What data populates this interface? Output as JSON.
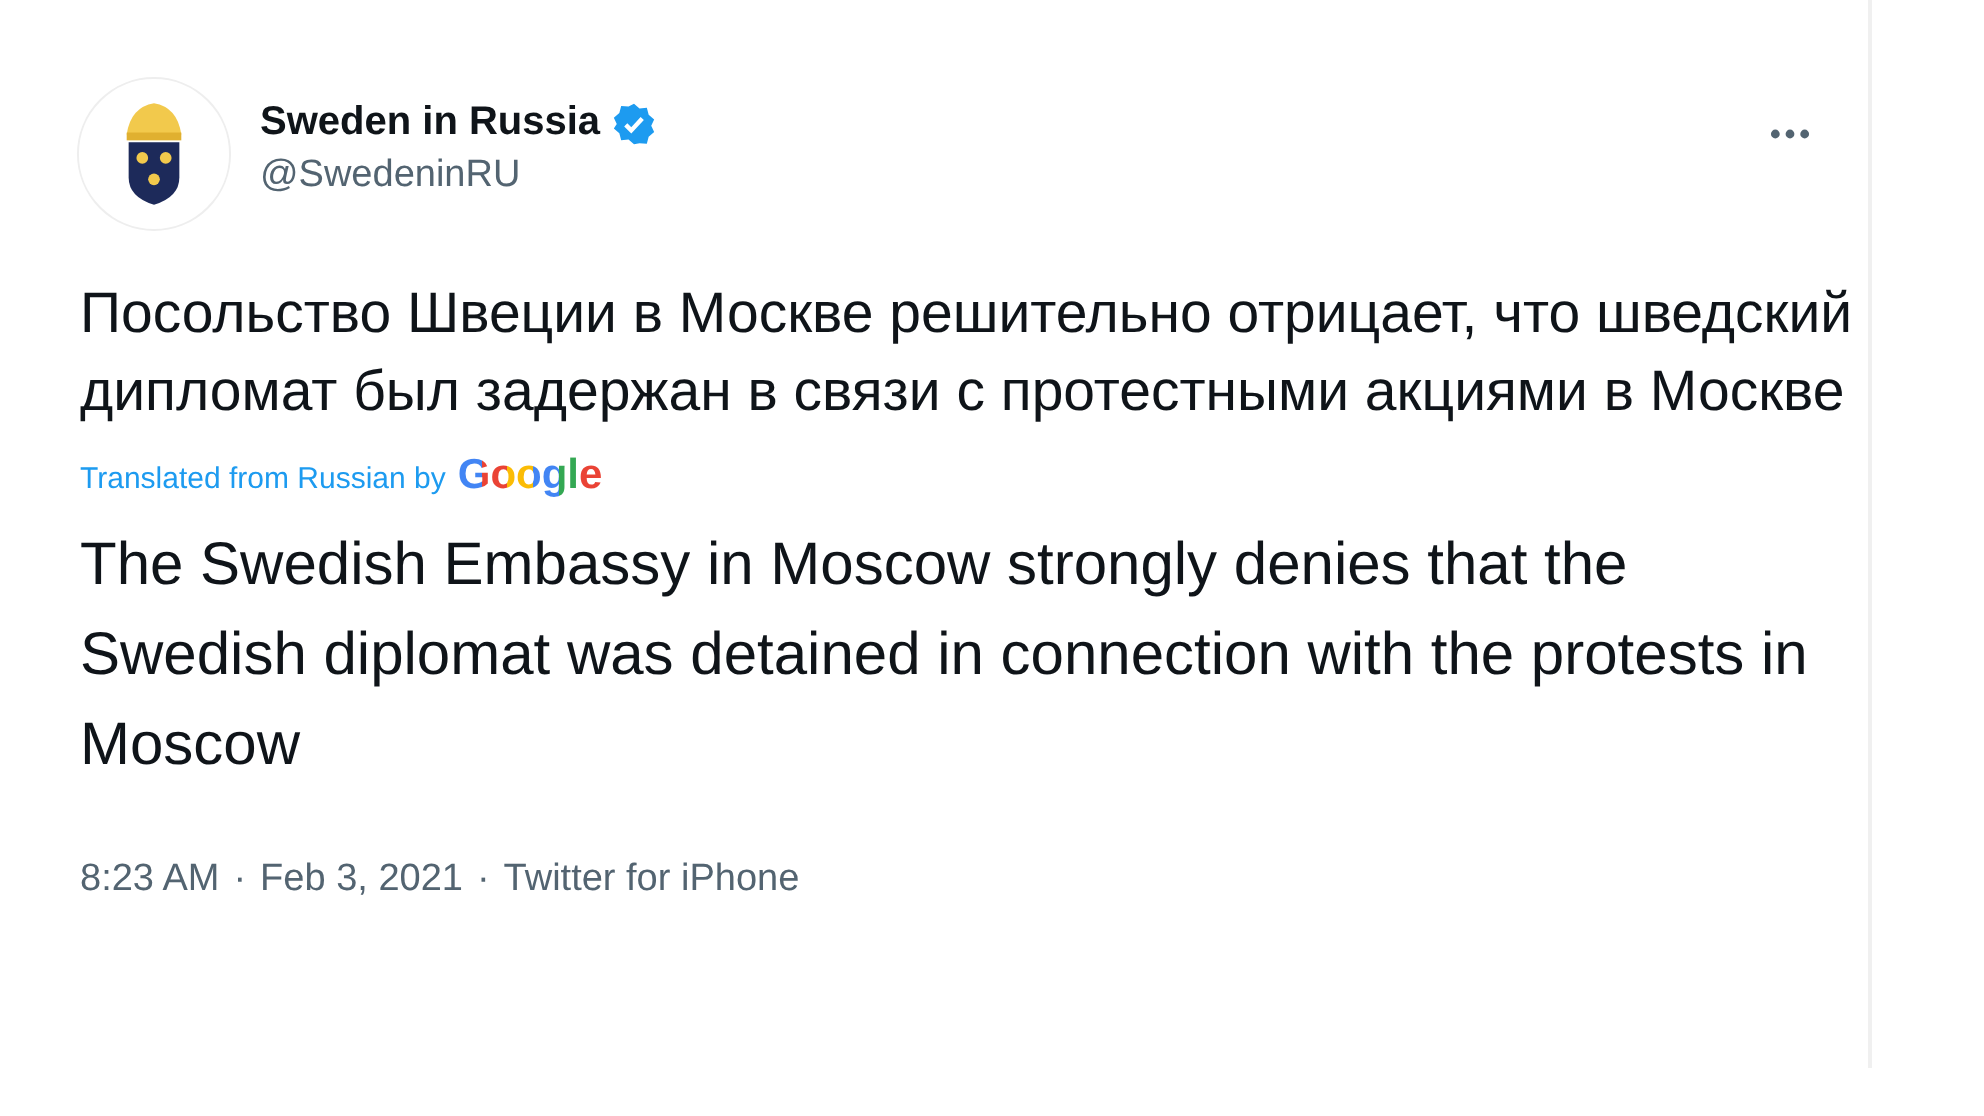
{
  "account": {
    "name": "Sweden in Russia",
    "verified": true,
    "handle": "@SwedeninRU"
  },
  "tweet": {
    "text": "Посольство Швеции в Москве решительно отрицает, что шведский дипломат был задержан в связи с протестными акциями в Москве",
    "translation_label": "Translated from Russian by",
    "translation_provider": "Google",
    "translation": "The Swedish Embassy in Moscow strongly denies that the Swedish diplomat was detained in connection with the protests in Moscow"
  },
  "meta": {
    "time": "8:23 AM",
    "date": "Feb 3, 2021",
    "source": "Twitter for iPhone",
    "separator": "·"
  }
}
